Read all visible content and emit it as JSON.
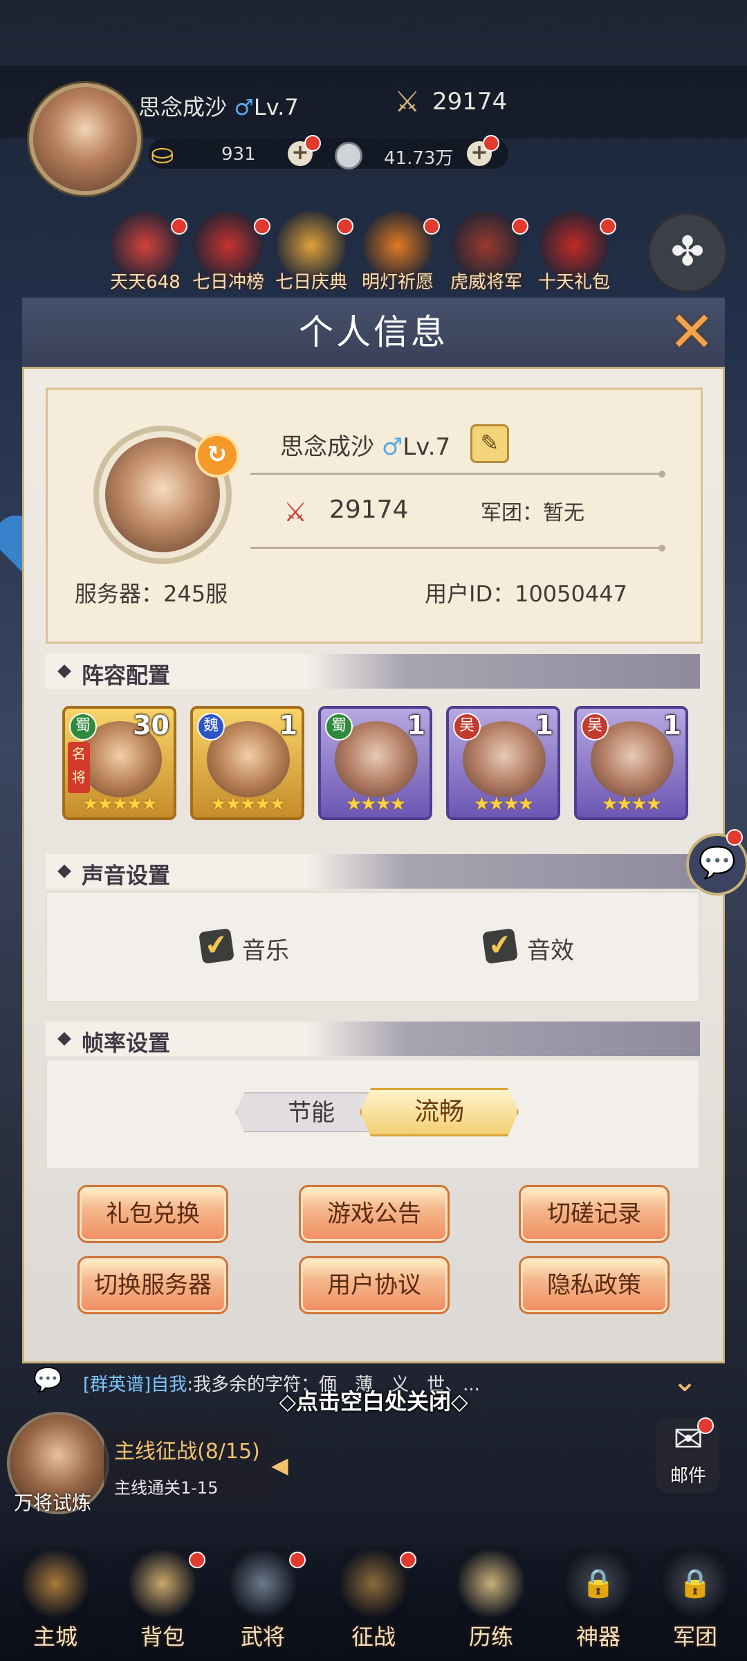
{
  "hud": {
    "player_name": "思念成沙",
    "gender_symbol": "♂",
    "level": "Lv.7",
    "power": "29174",
    "gold": "931",
    "silver": "41.73万",
    "plus_symbol": "+"
  },
  "activities": [
    {
      "label": "天天648",
      "color": "#d3413b"
    },
    {
      "label": "七日冲榜",
      "color": "#c8322d"
    },
    {
      "label": "七日庆典",
      "color": "#e0a23a"
    },
    {
      "label": "明灯祈愿",
      "color": "#e27a23"
    },
    {
      "label": "虎威将军",
      "color": "#9a3a2c"
    },
    {
      "label": "十天礼包",
      "color": "#c02a25"
    }
  ],
  "modal": {
    "title": "个人信息",
    "close_symbol": "✕",
    "profile": {
      "name": "思念成沙",
      "gender_symbol": "♂",
      "level": "Lv.7",
      "power": "29174",
      "legion": "军团：暂无",
      "server": "服务器：245服",
      "user_id": "用户ID：10050447"
    },
    "lineup": {
      "title": "阵容配置",
      "heroes": [
        {
          "kingdom": "蜀",
          "level": "30",
          "stars": "★★★★★",
          "rarity": "gold",
          "famous": "名将"
        },
        {
          "kingdom": "魏",
          "level": "1",
          "stars": "★★★★★",
          "rarity": "gold",
          "famous": ""
        },
        {
          "kingdom": "蜀",
          "level": "1",
          "stars": "★★★★",
          "rarity": "purple",
          "famous": ""
        },
        {
          "kingdom": "吴",
          "level": "1",
          "stars": "★★★★",
          "rarity": "purple",
          "famous": ""
        },
        {
          "kingdom": "吴",
          "level": "1",
          "stars": "★★★★",
          "rarity": "purple",
          "famous": ""
        }
      ]
    },
    "sound": {
      "title": "声音设置",
      "music": "音乐",
      "effects": "音效",
      "music_on": true,
      "effects_on": true
    },
    "framerate": {
      "title": "帧率设置",
      "option_saving": "节能",
      "option_smooth": "流畅",
      "selected": "流畅"
    },
    "buttons": {
      "gift_redeem": "礼包兑换",
      "announcement": "游戏公告",
      "duel_record": "切磋记录",
      "switch_server": "切换服务器",
      "user_agreement": "用户协议",
      "privacy_policy": "隐私政策"
    }
  },
  "chat": {
    "channel": "[群英谱]",
    "sender": "自我",
    "message": ":我多余的字符：偭　薄　义　世、..."
  },
  "close_hint": "◇点击空白处关闭◇",
  "quest": {
    "avatar_label": "万将试炼",
    "title": "主线征战(8/15)",
    "subtitle": "主线通关1-15"
  },
  "mail": {
    "label": "邮件"
  },
  "nav": [
    {
      "label": "主城"
    },
    {
      "label": "背包"
    },
    {
      "label": "武将"
    },
    {
      "label": "征战"
    },
    {
      "label": "历练"
    },
    {
      "label": "神器"
    },
    {
      "label": "军团"
    }
  ]
}
